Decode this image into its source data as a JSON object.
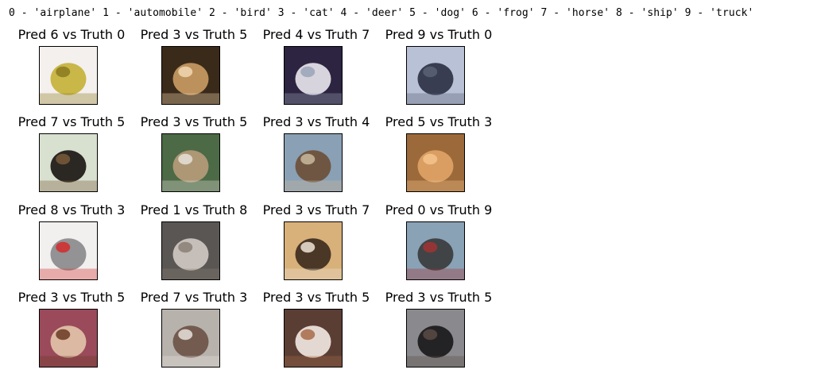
{
  "legend": "0 - 'airplane' 1 - 'automobile' 2 - 'bird' 3 - 'cat' 4 - 'deer' 5 - 'dog' 6 - 'frog' 7 - 'horse' 8 - 'ship' 9 - 'truck'",
  "cells": [
    {
      "caption": "Pred 6 vs Truth 0",
      "thumb": "yellow-airplane-thumbnail",
      "bg": "#f4f0ee",
      "fg": "#c4b23a",
      "accent": "#8a7a20"
    },
    {
      "caption": "Pred 3 vs Truth 5",
      "thumb": "chihuahua-dog-thumbnail",
      "bg": "#3a2a1a",
      "fg": "#c89a62",
      "accent": "#f1d7b0"
    },
    {
      "caption": "Pred 4 vs Truth 7",
      "thumb": "white-horse-rider-thumbnail",
      "bg": "#2c2440",
      "fg": "#e7e4ea",
      "accent": "#9aa3b8"
    },
    {
      "caption": "Pred 9 vs Truth 0",
      "thumb": "jet-airplane-thumbnail",
      "bg": "#b9c1d6",
      "fg": "#2c3246",
      "accent": "#5a6275"
    },
    {
      "caption": "Pred 7 vs Truth 5",
      "thumb": "black-doberman-thumbnail",
      "bg": "#d8e0d0",
      "fg": "#1c1714",
      "accent": "#7a5a38"
    },
    {
      "caption": "Pred 3 vs Truth 5",
      "thumb": "dog-on-book-thumbnail",
      "bg": "#4b6a45",
      "fg": "#b59b7a",
      "accent": "#e5e0d8"
    },
    {
      "caption": "Pred 3 vs Truth 4",
      "thumb": "deer-head-thumbnail",
      "bg": "#8aa0b4",
      "fg": "#6c4f3a",
      "accent": "#c9b89e"
    },
    {
      "caption": "Pred 5 vs Truth 3",
      "thumb": "orange-cat-thumbnail",
      "bg": "#9c6a3a",
      "fg": "#e0a266",
      "accent": "#f4c48c"
    },
    {
      "caption": "Pred 8 vs Truth 3",
      "thumb": "gray-cat-red-toy-thumbnail",
      "bg": "#f1f0ef",
      "fg": "#8b8a8c",
      "accent": "#d42a2a"
    },
    {
      "caption": "Pred 1 vs Truth 8",
      "thumb": "boat-hull-thumbnail",
      "bg": "#5a5654",
      "fg": "#cfc8c2",
      "accent": "#8a7f76"
    },
    {
      "caption": "Pred 3 vs Truth 7",
      "thumb": "horse-rider-desert-thumbnail",
      "bg": "#d8b07a",
      "fg": "#3e2c1e",
      "accent": "#eee4d8"
    },
    {
      "caption": "Pred 0 vs Truth 9",
      "thumb": "truck-road-thumbnail",
      "bg": "#8aa2b6",
      "fg": "#3a3c3e",
      "accent": "#a23232"
    },
    {
      "caption": "Pred 3 vs Truth 5",
      "thumb": "puppy-flowers-thumbnail",
      "bg": "#9a4a5a",
      "fg": "#e2c2a8",
      "accent": "#6a3a24"
    },
    {
      "caption": "Pred 7 vs Truth 3",
      "thumb": "brown-white-cat-thumbnail",
      "bg": "#b8b2ac",
      "fg": "#6c5446",
      "accent": "#e8e2dc"
    },
    {
      "caption": "Pred 3 vs Truth 5",
      "thumb": "sleeping-puppy-thumbnail",
      "bg": "#5a3e34",
      "fg": "#f0e6e0",
      "accent": "#a86a4a"
    },
    {
      "caption": "Pred 3 vs Truth 5",
      "thumb": "black-fluffy-dog-thumbnail",
      "bg": "#8a8a8e",
      "fg": "#1a1a1c",
      "accent": "#5a4a44"
    }
  ]
}
